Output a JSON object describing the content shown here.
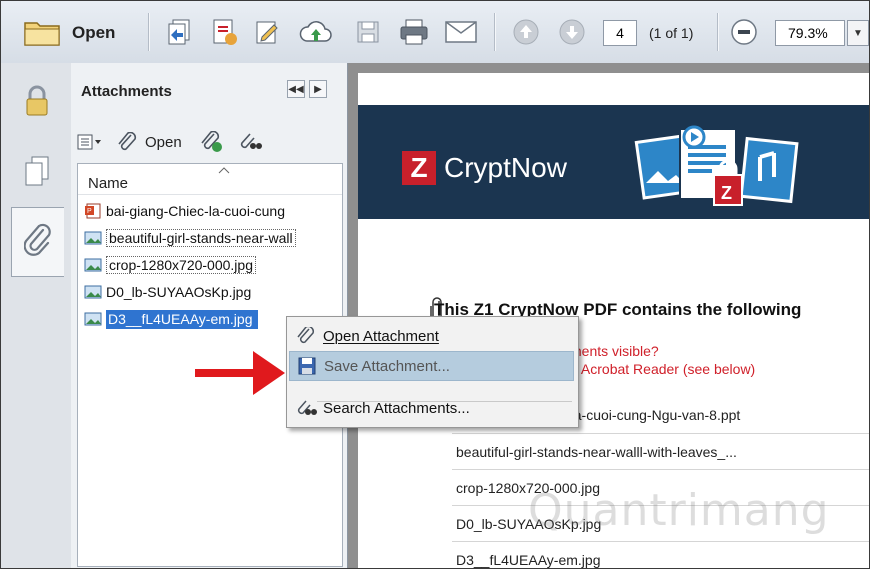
{
  "toolbar": {
    "open_label": "Open",
    "page_number": "4",
    "page_of": "(1 of 1)",
    "zoom": "79.3%",
    "icons": [
      "folder-icon",
      "combine-files-icon",
      "create-pdf-icon",
      "edit-icon",
      "cloud-upload-icon",
      "save-icon",
      "print-icon",
      "email-icon",
      "previous-page-icon",
      "next-page-icon",
      "zoom-out-icon",
      "zoom-dropdown-icon"
    ]
  },
  "left_rail": {
    "tabs": [
      "lock-icon",
      "pages-icon",
      "paperclip-icon"
    ],
    "active_tab": "paperclip-icon"
  },
  "attachments_panel": {
    "title": "Attachments",
    "tools": {
      "open_label": "Open"
    },
    "column_header": "Name",
    "items": [
      {
        "name": "bai-giang-Chiec-la-cuoi-cung",
        "type": "ppt"
      },
      {
        "name": "beautiful-girl-stands-near-wall",
        "type": "image"
      },
      {
        "name": "crop-1280x720-000.jpg",
        "type": "image"
      },
      {
        "name": "D0_lb-SUYAAOsKp.jpg",
        "type": "image"
      },
      {
        "name": "D3__fL4UEAAy-em.jpg",
        "type": "image",
        "selected": true
      }
    ]
  },
  "document": {
    "brand": "CryptNow",
    "brand_letter": "Z",
    "contains_heading": "This Z1 CryptNow PDF contains the following",
    "red_line1": "ments visible?",
    "red_line2": "e Acrobat Reader (see below)",
    "files": [
      "-la-cuoi-cung-Ngu-van-8.ppt",
      "beautiful-girl-stands-near-walll-with-leaves_...",
      "crop-1280x720-000.jpg",
      "D0_lb-SUYAAOsKp.jpg",
      "D3__fL4UEAAy-em.jpg"
    ],
    "watermark": "Quantrimang"
  },
  "context_menu": {
    "items": [
      {
        "label": "Open Attachment",
        "icon": "open-attachment-icon"
      },
      {
        "label": "Save Attachment...",
        "icon": "save-attachment-icon",
        "highlighted": true
      },
      {
        "label": "Search Attachments...",
        "icon": "search-attachments-icon"
      }
    ]
  },
  "colors": {
    "banner": "#1b3550",
    "brand_red": "#c8202b",
    "selection": "#2f74d0",
    "menu_highlight": "#b5ccde",
    "arrow": "#e0191d"
  }
}
